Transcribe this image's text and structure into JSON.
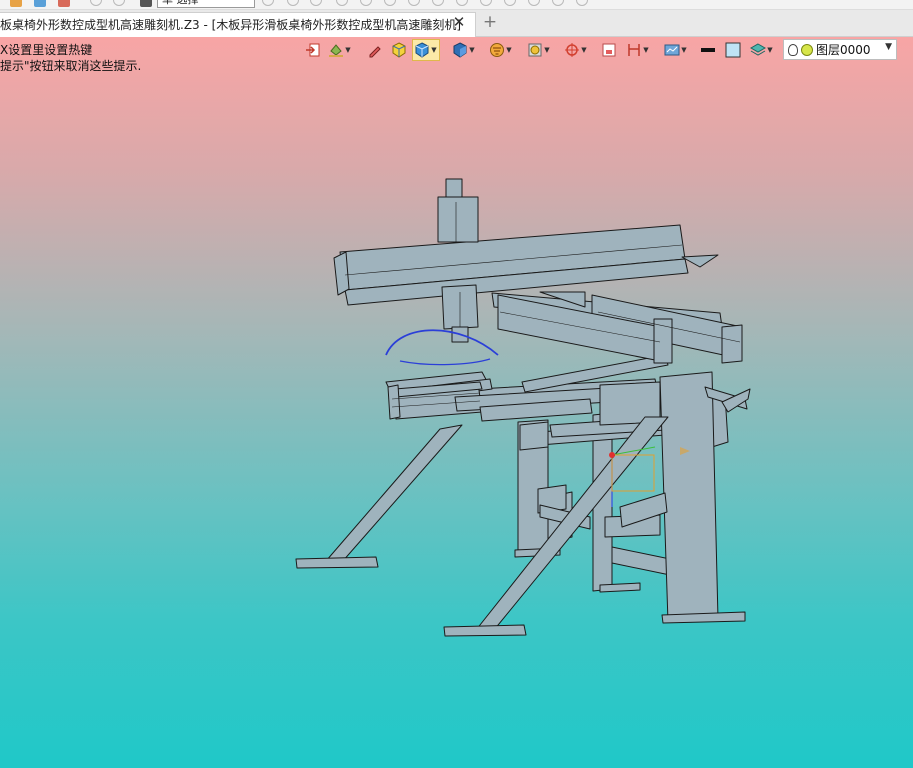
{
  "toolbar_top": {
    "selection_filter": "单   选择"
  },
  "tabs": [
    {
      "label": "板桌椅外形数控成型机高速雕刻机.Z3 - [木板异形滑板桌椅外形数控成型机高速雕刻机]",
      "active": true
    }
  ],
  "tab_close": "✕",
  "tab_add": "+",
  "hints": [
    "X设置里设置热键",
    "提示\"按钮来取消这些提示."
  ],
  "view_toolbar": {
    "layer_name": "图层0000",
    "icons": [
      "exit-sketch-icon",
      "paint-bucket-icon",
      "pen-icon",
      "view-cube-icon",
      "shaded-display-icon",
      "view-orientation-icon",
      "filter-icon",
      "render-mode-icon",
      "snap-icon",
      "section-icon",
      "dimension-icon",
      "display-settings-icon",
      "line-color-icon",
      "fill-color-icon",
      "layer-stack-icon"
    ]
  },
  "colors": {
    "viewport_top": "#f8a5a5",
    "viewport_bottom": "#1fc8c8",
    "machine_fill": "#9fb3bd",
    "machine_stroke": "#1a1a1a",
    "highlight_curve": "#2b3fd8"
  }
}
